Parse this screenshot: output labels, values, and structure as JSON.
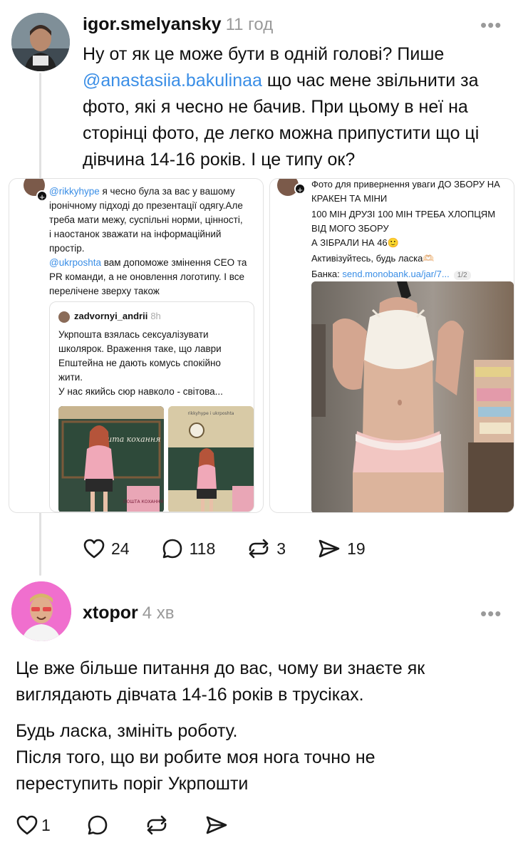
{
  "post1": {
    "username": "igor.smelyansky",
    "time": "11 год",
    "text_parts": {
      "line1": "Ну от як це може бути в одній голові? Пише",
      "mention": "@anastasiia.bakulinaa",
      "line2_rest": " що час мене звільнити за",
      "line3": "фото, які я чесно не бачив. При цьому в неї на",
      "line4": "сторінці фото, де легко можна припустити що ці",
      "line5": "дівчина 14-16 років. І це типу ок?"
    },
    "left_shot": {
      "mention1": "@rikkyhype",
      "line1_rest": " я чесно була за вас у вашому",
      "line2": "іронічному підході до презентації одягу.Але",
      "line3": "треба мати межу, суспільні норми, цінності,",
      "line4": "і наостанок зважати на інформаційний",
      "line5": "простір.",
      "mention2": "@ukrposhta",
      "line6_rest": " вам допоможе змінення СЕО та",
      "line7": "PR команди, а не оновлення логотипу. І все",
      "line8": "перелічене зверху також",
      "quote_user": "zadvornyi_andrii",
      "quote_time": "8h",
      "quote_line1": "Укрпошта взялась сексуалізувати",
      "quote_line2": "школярок. Враження таке, що лаври",
      "quote_line3": "Епштейна не дають комусь спокійно",
      "quote_line4": "жити.",
      "quote_line5": "У нас якийсь сюр навколо - світова...",
      "photo2_caption": "rikkyhype i ukrposhta",
      "board_text": "Пошта кохання",
      "box_text": "ПОШТА КОХАННЯ"
    },
    "right_shot": {
      "line1": "Фото для привернення уваги ДО ЗБОРУ НА",
      "line2": "КРАКЕН ТА МІНИ",
      "line3": "100 МІН ДРУЗІ 100 МІН ТРЕБА ХЛОПЦЯМ",
      "line4": "ВІД МОГО ЗБОРУ",
      "line5": "А ЗІБРАЛИ НА 46🙂",
      "line6": "Активізуйтесь, будь ласка🫶🏻",
      "bank_label": "Банка: ",
      "bank_link": "send.monobank.ua/jar/7...",
      "pager": "1/2"
    },
    "actions": {
      "likes": "24",
      "comments": "118",
      "reposts": "3",
      "shares": "19"
    }
  },
  "post2": {
    "username": "xtopor",
    "time": "4 хв",
    "paragraph1_line1": "Це вже більше питання до вас, чому ви знаєте як",
    "paragraph1_line2": "виглядають дівчата 14-16 років в трусіках.",
    "paragraph2_line1": "Будь ласка, змініть роботу.",
    "paragraph2_line2": "Після того, що ви робите моя нога точно не",
    "paragraph2_line3": "переступить поріг Укрпошти",
    "actions": {
      "likes": "1"
    }
  },
  "icons": {
    "more": "more-horizontal-icon",
    "like": "heart-icon",
    "comment": "comment-bubble-icon",
    "repost": "repost-icon",
    "share": "send-icon"
  },
  "colors": {
    "mention": "#3a8ee6",
    "muted": "#9a9a9a",
    "text": "#101010"
  }
}
